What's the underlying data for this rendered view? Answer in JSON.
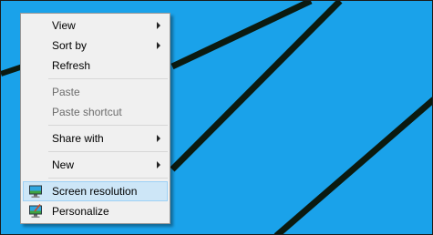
{
  "desktop": {
    "background": "#1aa2ea",
    "line_color": "#0b1a10"
  },
  "menu": {
    "items": [
      {
        "label": "View",
        "submenu": true,
        "disabled": false
      },
      {
        "label": "Sort by",
        "submenu": true,
        "disabled": false
      },
      {
        "label": "Refresh",
        "submenu": false,
        "disabled": false
      },
      {
        "label": "Paste",
        "submenu": false,
        "disabled": true
      },
      {
        "label": "Paste shortcut",
        "submenu": false,
        "disabled": true
      },
      {
        "label": "Share with",
        "submenu": true,
        "disabled": false
      },
      {
        "label": "New",
        "submenu": true,
        "disabled": false
      },
      {
        "label": "Screen resolution",
        "icon": "screen-resolution-icon",
        "highlighted": true
      },
      {
        "label": "Personalize",
        "icon": "personalize-icon"
      }
    ]
  }
}
